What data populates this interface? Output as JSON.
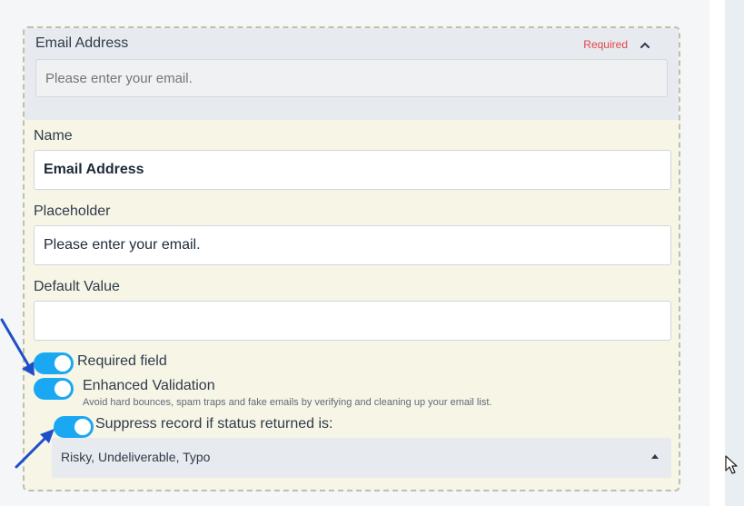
{
  "field": {
    "title": "Email Address",
    "required_tag": "Required",
    "preview_placeholder": "Please enter your email."
  },
  "settings": {
    "name_label": "Name",
    "name_value": "Email Address",
    "placeholder_label": "Placeholder",
    "placeholder_value": "Please enter your email.",
    "default_value_label": "Default Value",
    "default_value": ""
  },
  "toggles": {
    "required_field": {
      "label": "Required field",
      "on": true
    },
    "enhanced_validation": {
      "label": "Enhanced Validation",
      "help": "Avoid hard bounces, spam traps and fake emails by verifying and cleaning up your email list.",
      "on": true
    },
    "suppress_record": {
      "label": "Suppress record if status returned is:",
      "on": true
    }
  },
  "suppress_select": {
    "selected": "Risky, Undeliverable, Typo"
  },
  "colors": {
    "toggle_on": "#1aa8f2",
    "required": "#e4424d",
    "annotation_arrow": "#1f4fc8"
  },
  "icons": [
    "chevron-up-icon",
    "caret-up-icon",
    "mouse-cursor-icon",
    "annotation-arrow-icon"
  ]
}
